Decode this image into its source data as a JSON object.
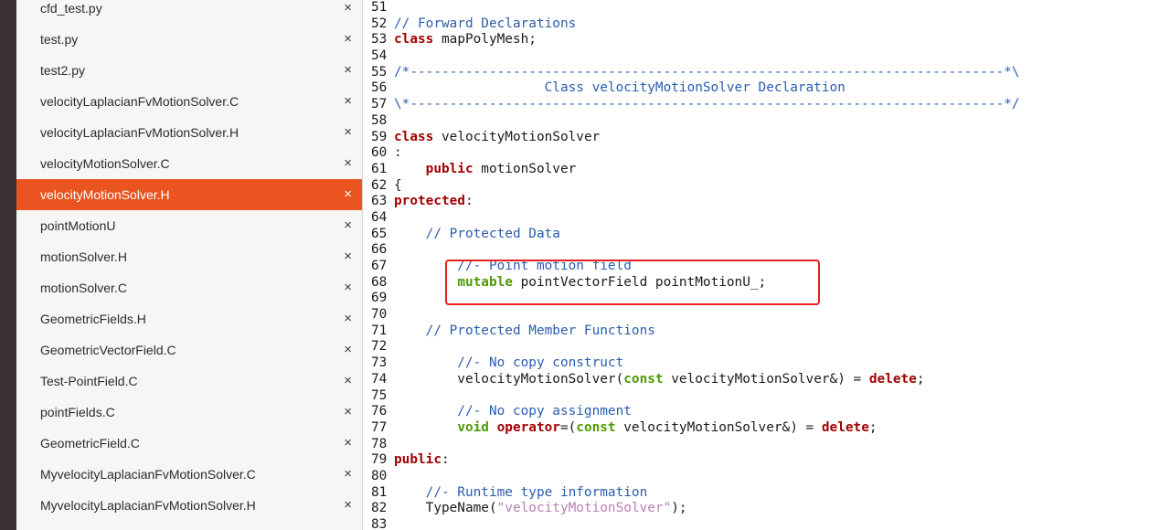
{
  "files": [
    {
      "name": "cfd_test.py",
      "active": false
    },
    {
      "name": "test.py",
      "active": false
    },
    {
      "name": "test2.py",
      "active": false
    },
    {
      "name": "velocityLaplacianFvMotionSolver.C",
      "active": false
    },
    {
      "name": "velocityLaplacianFvMotionSolver.H",
      "active": false
    },
    {
      "name": "velocityMotionSolver.C",
      "active": false
    },
    {
      "name": "velocityMotionSolver.H",
      "active": true
    },
    {
      "name": "pointMotionU",
      "active": false
    },
    {
      "name": "motionSolver.H",
      "active": false
    },
    {
      "name": "motionSolver.C",
      "active": false
    },
    {
      "name": "GeometricFields.H",
      "active": false
    },
    {
      "name": "GeometricVectorField.C",
      "active": false
    },
    {
      "name": "Test-PointField.C",
      "active": false
    },
    {
      "name": "pointFields.C",
      "active": false
    },
    {
      "name": "GeometricField.C",
      "active": false
    },
    {
      "name": "MyvelocityLaplacianFvMotionSolver.C",
      "active": false
    },
    {
      "name": "MyvelocityLaplacianFvMotionSolver.H",
      "active": false
    }
  ],
  "close_glyph": "×",
  "colors": {
    "active_tab": "#e95420",
    "comment": "#2a5db0",
    "keyword": "#a40000",
    "type": "#4e9a06",
    "string": "#b87fb5",
    "highlight_box": "#e8201f"
  },
  "code_lines": [
    {
      "n": "51",
      "tokens": []
    },
    {
      "n": "52",
      "tokens": [
        {
          "t": "// Forward Declarations",
          "c": "comment"
        }
      ]
    },
    {
      "n": "53",
      "tokens": [
        {
          "t": "class",
          "c": "keyword"
        },
        {
          "t": " mapPolyMesh;",
          "c": ""
        }
      ]
    },
    {
      "n": "54",
      "tokens": []
    },
    {
      "n": "55",
      "tokens": [
        {
          "t": "/*---------------------------------------------------------------------------*\\",
          "c": "comment"
        }
      ]
    },
    {
      "n": "56",
      "tokens": [
        {
          "t": "                   Class velocityMotionSolver Declaration",
          "c": "comment"
        }
      ]
    },
    {
      "n": "57",
      "tokens": [
        {
          "t": "\\*---------------------------------------------------------------------------*/",
          "c": "comment"
        }
      ]
    },
    {
      "n": "58",
      "tokens": []
    },
    {
      "n": "59",
      "tokens": [
        {
          "t": "class",
          "c": "keyword"
        },
        {
          "t": " velocityMotionSolver",
          "c": ""
        }
      ]
    },
    {
      "n": "60",
      "tokens": [
        {
          "t": ":",
          "c": ""
        }
      ]
    },
    {
      "n": "61",
      "tokens": [
        {
          "t": "    ",
          "c": ""
        },
        {
          "t": "public",
          "c": "keyword"
        },
        {
          "t": " motionSolver",
          "c": ""
        }
      ]
    },
    {
      "n": "62",
      "tokens": [
        {
          "t": "{",
          "c": ""
        }
      ]
    },
    {
      "n": "63",
      "tokens": [
        {
          "t": "protected",
          "c": "keyword"
        },
        {
          "t": ":",
          "c": ""
        }
      ]
    },
    {
      "n": "64",
      "tokens": []
    },
    {
      "n": "65",
      "tokens": [
        {
          "t": "    // Protected Data",
          "c": "comment"
        }
      ]
    },
    {
      "n": "66",
      "tokens": []
    },
    {
      "n": "67",
      "tokens": [
        {
          "t": "        //- Point motion field",
          "c": "comment"
        }
      ]
    },
    {
      "n": "68",
      "tokens": [
        {
          "t": "        ",
          "c": ""
        },
        {
          "t": "mutable",
          "c": "type"
        },
        {
          "t": " pointVectorField pointMotionU_;",
          "c": ""
        }
      ]
    },
    {
      "n": "69",
      "tokens": []
    },
    {
      "n": "70",
      "tokens": []
    },
    {
      "n": "71",
      "tokens": [
        {
          "t": "    // Protected Member Functions",
          "c": "comment"
        }
      ]
    },
    {
      "n": "72",
      "tokens": []
    },
    {
      "n": "73",
      "tokens": [
        {
          "t": "        //- No copy construct",
          "c": "comment"
        }
      ]
    },
    {
      "n": "74",
      "tokens": [
        {
          "t": "        velocityMotionSolver(",
          "c": ""
        },
        {
          "t": "const",
          "c": "type"
        },
        {
          "t": " velocityMotionSolver&) = ",
          "c": ""
        },
        {
          "t": "delete",
          "c": "keyword"
        },
        {
          "t": ";",
          "c": ""
        }
      ]
    },
    {
      "n": "75",
      "tokens": []
    },
    {
      "n": "76",
      "tokens": [
        {
          "t": "        //- No copy assignment",
          "c": "comment"
        }
      ]
    },
    {
      "n": "77",
      "tokens": [
        {
          "t": "        ",
          "c": ""
        },
        {
          "t": "void",
          "c": "type"
        },
        {
          "t": " ",
          "c": ""
        },
        {
          "t": "operator",
          "c": "keyword"
        },
        {
          "t": "=(",
          "c": ""
        },
        {
          "t": "const",
          "c": "type"
        },
        {
          "t": " velocityMotionSolver&) = ",
          "c": ""
        },
        {
          "t": "delete",
          "c": "keyword"
        },
        {
          "t": ";",
          "c": ""
        }
      ]
    },
    {
      "n": "78",
      "tokens": []
    },
    {
      "n": "79",
      "tokens": [
        {
          "t": "public",
          "c": "keyword"
        },
        {
          "t": ":",
          "c": ""
        }
      ]
    },
    {
      "n": "80",
      "tokens": []
    },
    {
      "n": "81",
      "tokens": [
        {
          "t": "    //- Runtime type information",
          "c": "comment"
        }
      ]
    },
    {
      "n": "82",
      "tokens": [
        {
          "t": "    TypeName(",
          "c": ""
        },
        {
          "t": "\"velocityMotionSolver\"",
          "c": "string"
        },
        {
          "t": ");",
          "c": ""
        }
      ]
    },
    {
      "n": "83",
      "tokens": []
    }
  ]
}
